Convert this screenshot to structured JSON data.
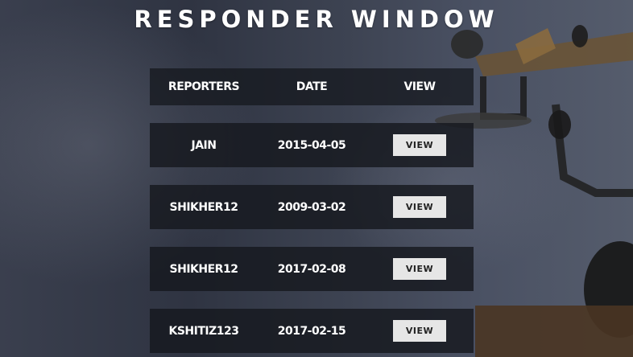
{
  "page": {
    "title": "RESPONDER WINDOW"
  },
  "table": {
    "headers": [
      "REPORTERS",
      "DATE",
      "VIEW"
    ],
    "rows": [
      {
        "reporter": "JAIN",
        "date": "2015-04-05",
        "action": "VIEW"
      },
      {
        "reporter": "SHIKHER12",
        "date": "2009-03-02",
        "action": "VIEW"
      },
      {
        "reporter": "SHIKHER12",
        "date": "2017-02-08",
        "action": "VIEW"
      },
      {
        "reporter": "KSHITIZ123",
        "date": "2017-02-15",
        "action": "VIEW"
      }
    ]
  },
  "colors": {
    "row_background": "#16181e",
    "button_background": "#e6e6e6",
    "text": "#ffffff"
  },
  "background": {
    "icon": "vintage-telephone-photo"
  }
}
